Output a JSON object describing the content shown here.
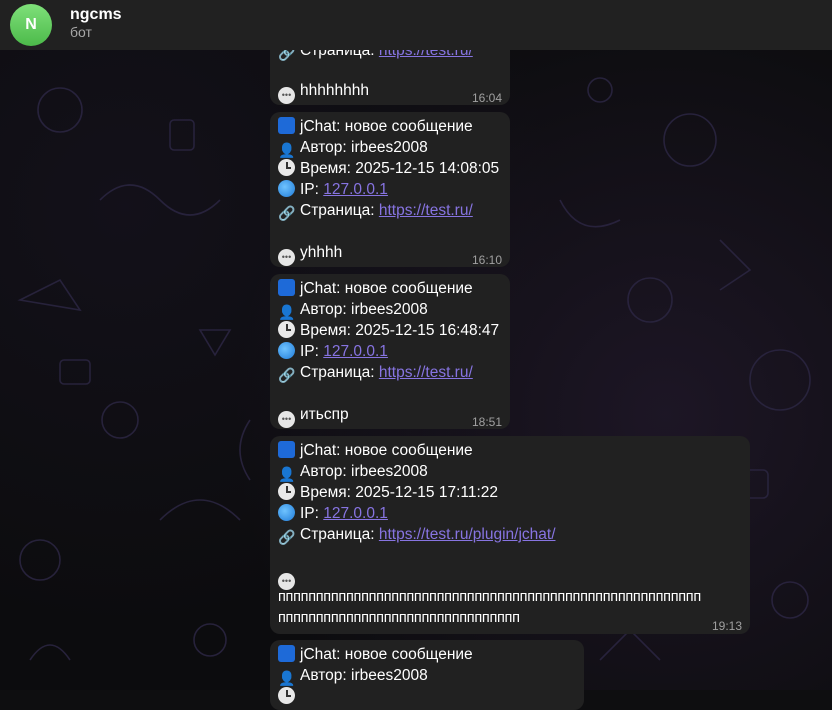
{
  "chat": {
    "title": "ngcms",
    "subtitle": "бот",
    "avatar_letter": "N"
  },
  "messages": [
    {
      "link_label": "Страница:",
      "link": "https://test.ru/",
      "text": "hhhhhhhh",
      "time": "16:04"
    },
    {
      "header": "jChat: новое сообщение",
      "author": "Автор: irbees2008",
      "datetime": "Время: 2025-12-15 14:08:05",
      "ip_label": "IP:",
      "ip": "127.0.0.1",
      "link_label": "Страница:",
      "link": "https://test.ru/",
      "text": "yhhhh",
      "time": "16:10"
    },
    {
      "header": "jChat: новое сообщение",
      "author": "Автор: irbees2008",
      "datetime": "Время: 2025-12-15 16:48:47",
      "ip_label": "IP:",
      "ip": "127.0.0.1",
      "link_label": "Страница:",
      "link": "https://test.ru/",
      "text": "итьспр",
      "time": "18:51"
    },
    {
      "header": "jChat: новое сообщение",
      "author": "Автор: irbees2008",
      "datetime": "Время: 2025-12-15 17:11:22",
      "ip_label": "IP:",
      "ip": "127.0.0.1",
      "link_label": "Страница:",
      "link": "https://test.ru/plugin/jchat/",
      "text_line1": "пппппппппппппппппппппппппппппппппппппппппппппппппппппппп",
      "text_line2": "пппппппппппппппппппппппппппппппп",
      "time": "19:13"
    },
    {
      "header": "jChat: новое сообщение",
      "author": "Автор: irbees2008"
    }
  ]
}
